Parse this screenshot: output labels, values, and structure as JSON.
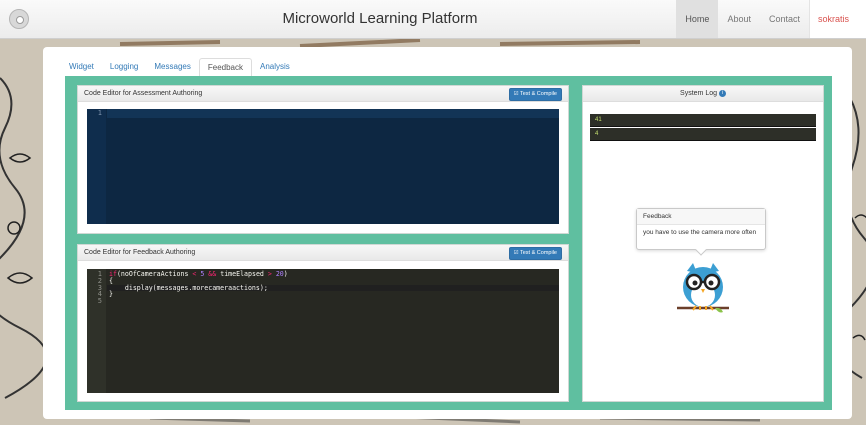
{
  "header": {
    "title": "Microworld Learning Platform",
    "nav": [
      "Home",
      "About",
      "Contact"
    ],
    "user": "sokratis"
  },
  "tabs": [
    "Widget",
    "Logging",
    "Messages",
    "Feedback",
    "Analysis"
  ],
  "active_tab": "Feedback",
  "assessment_panel": {
    "title": "Code Editor for Assessment Authoring",
    "button": "Test & Compile",
    "line_numbers": [
      "1"
    ]
  },
  "feedback_panel": {
    "title": "Code Editor for Feedback Authoring",
    "button": "Test & Compile",
    "line_numbers": [
      "1",
      "2",
      "3",
      "4",
      "5"
    ],
    "code": {
      "l1_kw": "if",
      "l1_a": "(noOfCameraActions ",
      "l1_op1": "<",
      "l1_n1": " 5 ",
      "l1_op2": "&&",
      "l1_b": " timeElapsed ",
      "l1_op3": ">",
      "l1_n2": " 20",
      "l1_c": ")",
      "l2": "{",
      "l3": "    display(messages.morecameraactions);",
      "l4": "}",
      "l5": ""
    }
  },
  "system_log": {
    "title": "System Log",
    "entries": [
      "41",
      "4"
    ],
    "popover": {
      "title": "Feedback",
      "body": "you have to use the camera more often"
    }
  },
  "colors": {
    "accent": "#5fbfa0",
    "primary_button": "#337ab7",
    "user_link": "#d9534f"
  },
  "icons": {
    "info": "info-circle-icon",
    "compile": "check-square-icon",
    "mascot": "owl-icon"
  }
}
